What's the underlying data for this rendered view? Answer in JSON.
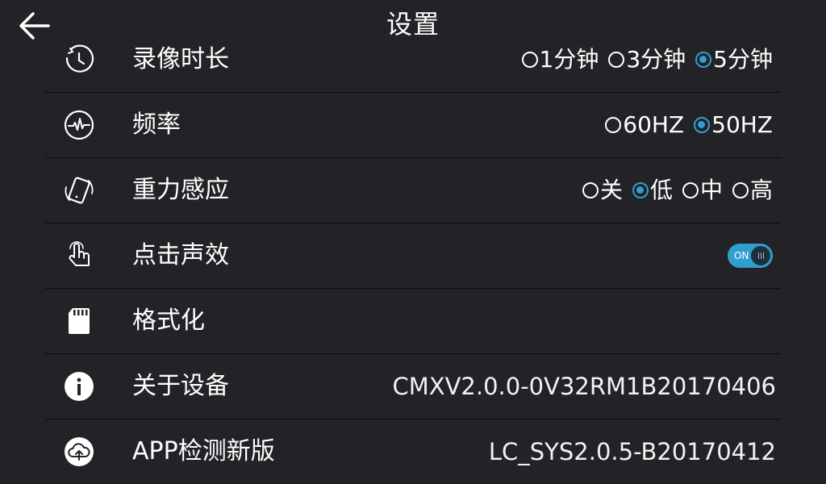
{
  "header": {
    "title": "设置",
    "back_icon": "back-arrow-icon"
  },
  "settings": {
    "record_duration": {
      "icon": "timer-icon",
      "label": "录像时长",
      "options": [
        {
          "label": "1分钟",
          "selected": false
        },
        {
          "label": "3分钟",
          "selected": false
        },
        {
          "label": "5分钟",
          "selected": true
        }
      ]
    },
    "frequency": {
      "icon": "frequency-waveform-icon",
      "label": "频率",
      "options": [
        {
          "label": "60HZ",
          "selected": false
        },
        {
          "label": "50HZ",
          "selected": true
        }
      ]
    },
    "gravity_sensor": {
      "icon": "gravity-sensor-icon",
      "label": "重力感应",
      "options": [
        {
          "label": "关",
          "selected": false
        },
        {
          "label": "低",
          "selected": true
        },
        {
          "label": "中",
          "selected": false
        },
        {
          "label": "高",
          "selected": false
        }
      ]
    },
    "click_sound": {
      "icon": "touch-hand-icon",
      "label": "点击声效",
      "toggle_label": "ON",
      "enabled": true
    },
    "format": {
      "icon": "sd-card-icon",
      "label": "格式化"
    },
    "about_device": {
      "icon": "info-icon",
      "label": "关于设备",
      "value": "CMXV2.0.0-0V32RM1B20170406"
    },
    "app_update": {
      "icon": "cloud-upload-icon",
      "label": "APP检测新版",
      "value": "LC_SYS2.0.5-B20170412"
    }
  },
  "colors": {
    "background": "#232327",
    "accent": "#2f9fd2",
    "divider": "#0c0c0e",
    "text": "#ffffff"
  }
}
